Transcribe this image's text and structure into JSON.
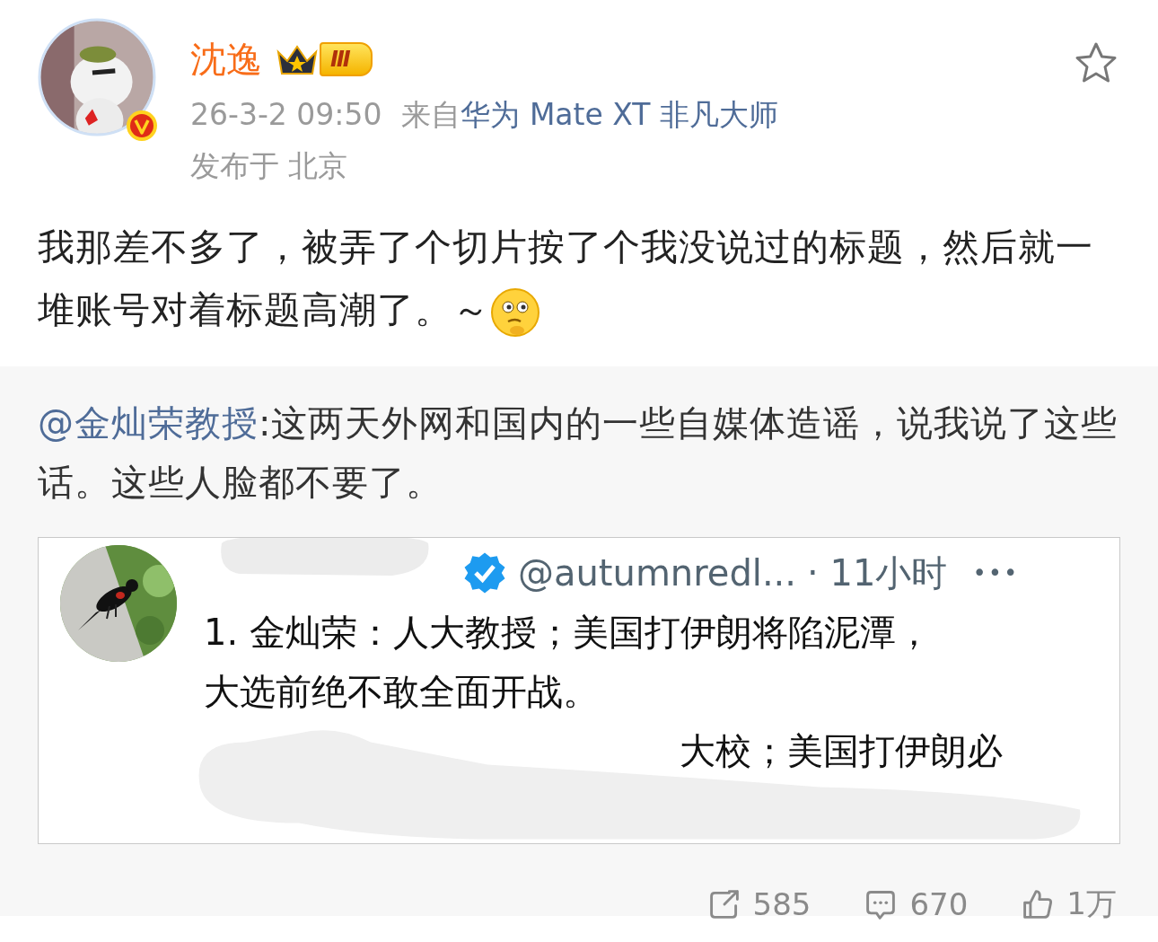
{
  "post": {
    "author": "沈逸",
    "level_badge": "Ⅲ",
    "verified": true,
    "time": "26-3-2 09:50",
    "source_prefix": "来自",
    "source": "华为 Mate XT 非凡大师",
    "location": "发布于 北京",
    "favorited": false,
    "text": "我那差不多了，被弄了个切片按了个我没说过的标题，然后就一堆账号对着标题高潮了。～"
  },
  "repost": {
    "mention": "@金灿荣教授",
    "text": ":这两天外网和国内的一些自媒体造谣，说我说了这些话。这些人脸都不要了。",
    "image": {
      "verified": true,
      "handle": "@autumnredl...",
      "time": "· 11小时",
      "more": "•••",
      "lines": [
        "1. 金灿荣：人大教授；美国打伊朗将陷泥潭，",
        "大选前绝不敢全面开战。"
      ],
      "partial_line": "大校；美国打伊朗必"
    }
  },
  "actions": [
    {
      "kind": "repost",
      "count": "585"
    },
    {
      "kind": "comment",
      "count": "670"
    },
    {
      "kind": "like",
      "count": "1万"
    }
  ]
}
